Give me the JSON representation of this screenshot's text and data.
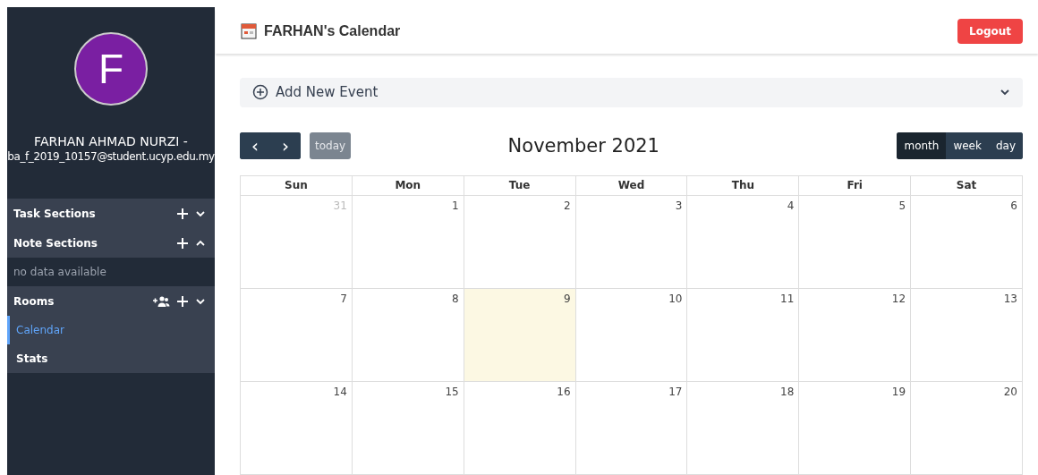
{
  "sidebar": {
    "avatar_letter": "F",
    "user_name": "FARHAN AHMAD NURZI -",
    "email": "ba_f_2019_10157@student.ucyp.edu.my",
    "sections": [
      {
        "kind": "section",
        "label": "Task Sections",
        "expanded": false,
        "add_member": false
      },
      {
        "kind": "section",
        "label": "Note Sections",
        "expanded": true,
        "add_member": false
      },
      {
        "kind": "empty",
        "label": "no data available"
      },
      {
        "kind": "section",
        "label": "Rooms",
        "expanded": false,
        "add_member": true
      },
      {
        "kind": "item",
        "label": "Calendar",
        "selected": true
      },
      {
        "kind": "item",
        "label": "Stats",
        "selected": false
      }
    ]
  },
  "header": {
    "title": "FARHAN's Calendar",
    "logout": "Logout"
  },
  "add_event": {
    "label": "Add New Event",
    "expanded": false
  },
  "toolbar": {
    "prev": "‹",
    "next": "›",
    "today": "today",
    "title": "November 2021",
    "views": [
      {
        "label": "month",
        "selected": true
      },
      {
        "label": "week",
        "selected": false
      },
      {
        "label": "day",
        "selected": false
      }
    ]
  },
  "calendar": {
    "weekdays": [
      "Sun",
      "Mon",
      "Tue",
      "Wed",
      "Thu",
      "Fri",
      "Sat"
    ],
    "weeks": [
      [
        {
          "day": "31",
          "other_month": true,
          "today": false
        },
        {
          "day": "1",
          "other_month": false,
          "today": false
        },
        {
          "day": "2",
          "other_month": false,
          "today": false
        },
        {
          "day": "3",
          "other_month": false,
          "today": false
        },
        {
          "day": "4",
          "other_month": false,
          "today": false
        },
        {
          "day": "5",
          "other_month": false,
          "today": false
        },
        {
          "day": "6",
          "other_month": false,
          "today": false
        }
      ],
      [
        {
          "day": "7",
          "other_month": false,
          "today": false
        },
        {
          "day": "8",
          "other_month": false,
          "today": false
        },
        {
          "day": "9",
          "other_month": false,
          "today": true
        },
        {
          "day": "10",
          "other_month": false,
          "today": false
        },
        {
          "day": "11",
          "other_month": false,
          "today": false
        },
        {
          "day": "12",
          "other_month": false,
          "today": false
        },
        {
          "day": "13",
          "other_month": false,
          "today": false
        }
      ],
      [
        {
          "day": "14",
          "other_month": false,
          "today": false
        },
        {
          "day": "15",
          "other_month": false,
          "today": false
        },
        {
          "day": "16",
          "other_month": false,
          "today": false
        },
        {
          "day": "17",
          "other_month": false,
          "today": false
        },
        {
          "day": "18",
          "other_month": false,
          "today": false
        },
        {
          "day": "19",
          "other_month": false,
          "today": false
        },
        {
          "day": "20",
          "other_month": false,
          "today": false
        }
      ]
    ]
  }
}
